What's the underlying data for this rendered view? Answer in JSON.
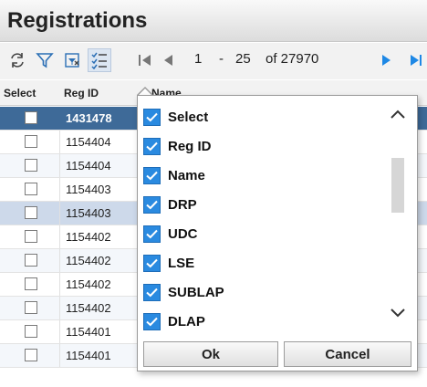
{
  "window": {
    "title": "Registrations"
  },
  "toolbar": {
    "pager": {
      "current_page": "1",
      "separator": "-",
      "page_size": "25",
      "total_label": "of 27970"
    }
  },
  "grid": {
    "headers": {
      "select": "Select",
      "reg_id": "Reg ID",
      "name": "Name"
    },
    "rows": [
      {
        "reg_id": "1431478"
      },
      {
        "reg_id": "1154404"
      },
      {
        "reg_id": "1154404"
      },
      {
        "reg_id": "1154403"
      },
      {
        "reg_id": "1154403"
      },
      {
        "reg_id": "1154402"
      },
      {
        "reg_id": "1154402"
      },
      {
        "reg_id": "1154402"
      },
      {
        "reg_id": "1154402"
      },
      {
        "reg_id": "1154401"
      },
      {
        "reg_id": "1154401"
      }
    ]
  },
  "column_chooser": {
    "items": [
      {
        "label": "Select",
        "checked": true
      },
      {
        "label": "Reg ID",
        "checked": true
      },
      {
        "label": "Name",
        "checked": true
      },
      {
        "label": "DRP",
        "checked": true
      },
      {
        "label": "UDC",
        "checked": true
      },
      {
        "label": "LSE",
        "checked": true
      },
      {
        "label": "SUBLAP",
        "checked": true
      },
      {
        "label": "DLAP",
        "checked": true
      }
    ],
    "ok_label": "Ok",
    "cancel_label": "Cancel"
  },
  "colors": {
    "accent": "#2a8ae0",
    "selected_row": "#3e6a98",
    "nav_arrow": "#1e88e5"
  }
}
